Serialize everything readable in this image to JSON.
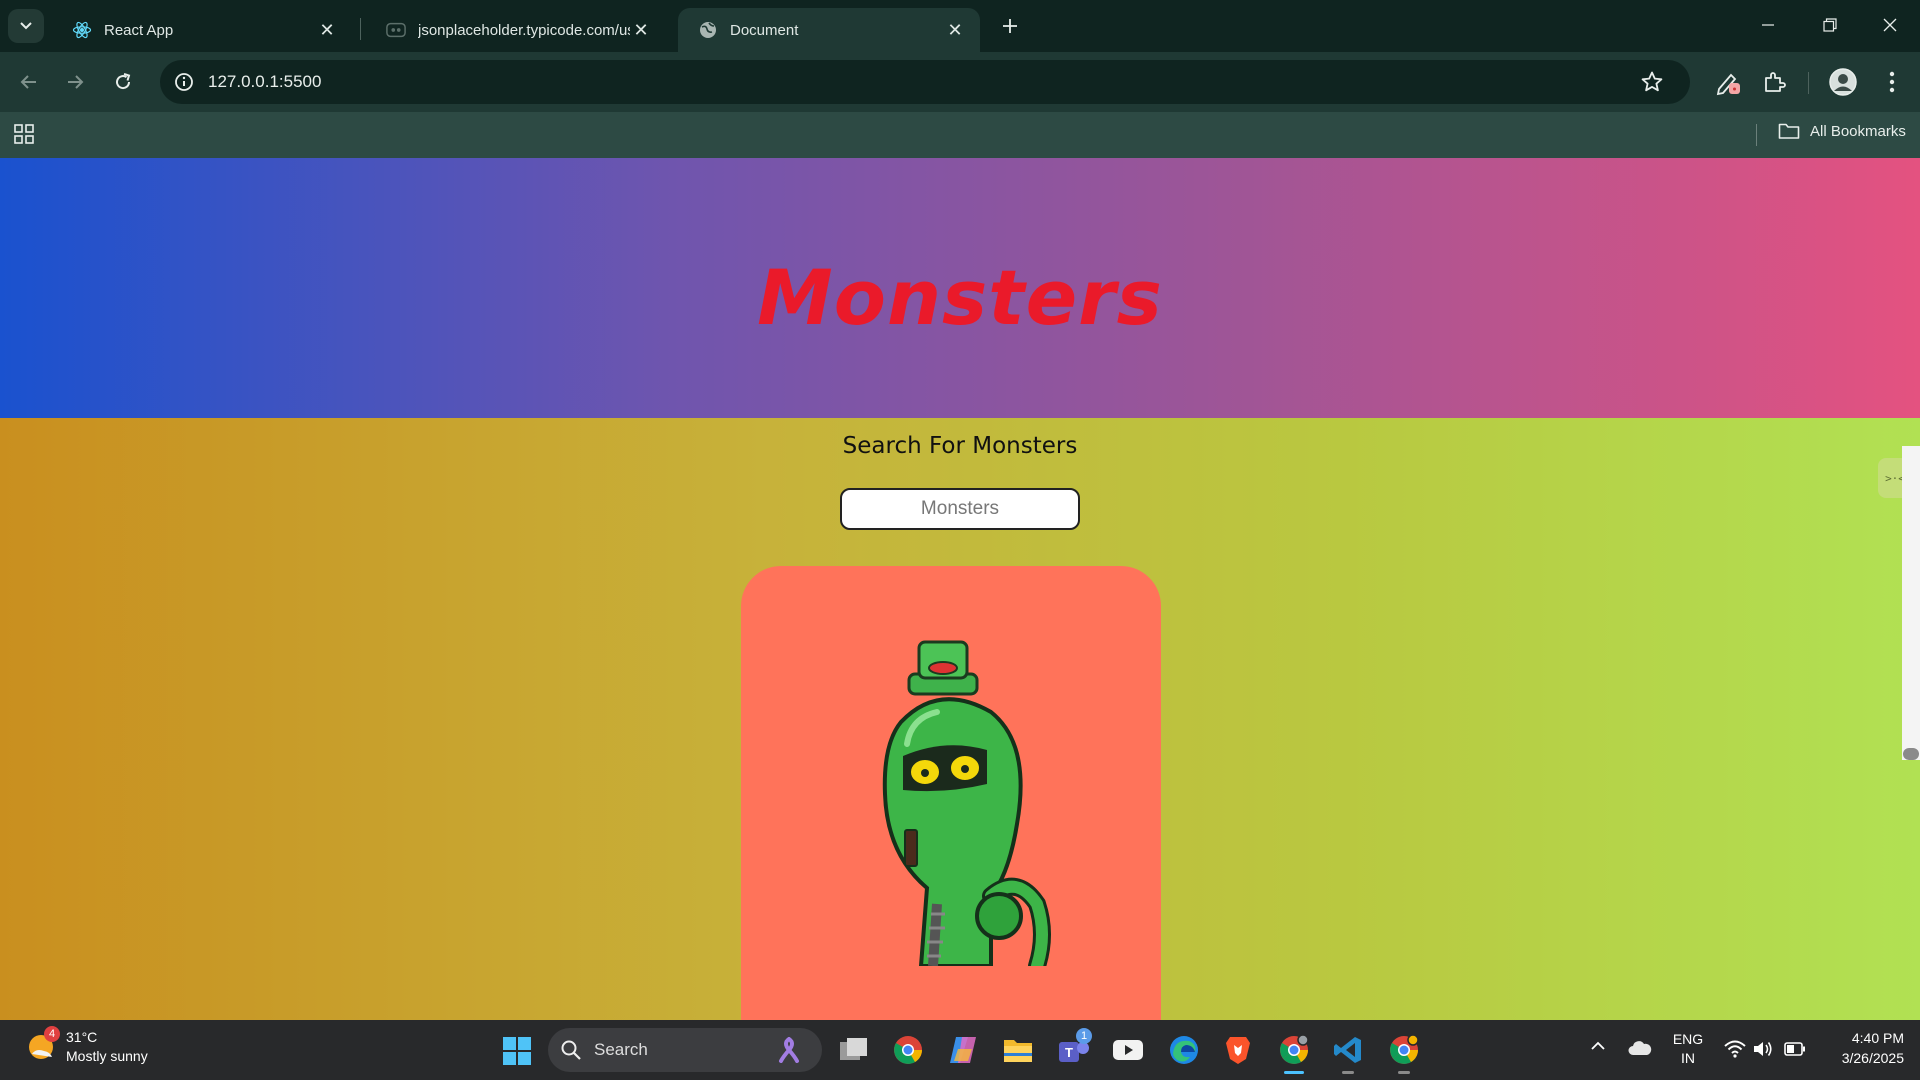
{
  "browser": {
    "tabs": [
      {
        "title": "React App",
        "active": false
      },
      {
        "title": "jsonplaceholder.typicode.com/users",
        "active": false
      },
      {
        "title": "Document",
        "active": true
      }
    ],
    "url": "127.0.0.1:5500",
    "bookmarks_label": "All Bookmarks"
  },
  "page": {
    "title": "Monsters",
    "search_heading": "Search For Monsters",
    "search_placeholder": "Monsters",
    "colors": {
      "title": "#ea1a2a",
      "card": "#ff735a"
    }
  },
  "taskbar": {
    "weather_temp": "31°C",
    "weather_desc": "Mostly sunny",
    "weather_badge": "4",
    "search_label": "Search",
    "teams_badge": "1",
    "lang_top": "ENG",
    "lang_bottom": "IN",
    "time": "4:40 PM",
    "date": "3/26/2025"
  }
}
